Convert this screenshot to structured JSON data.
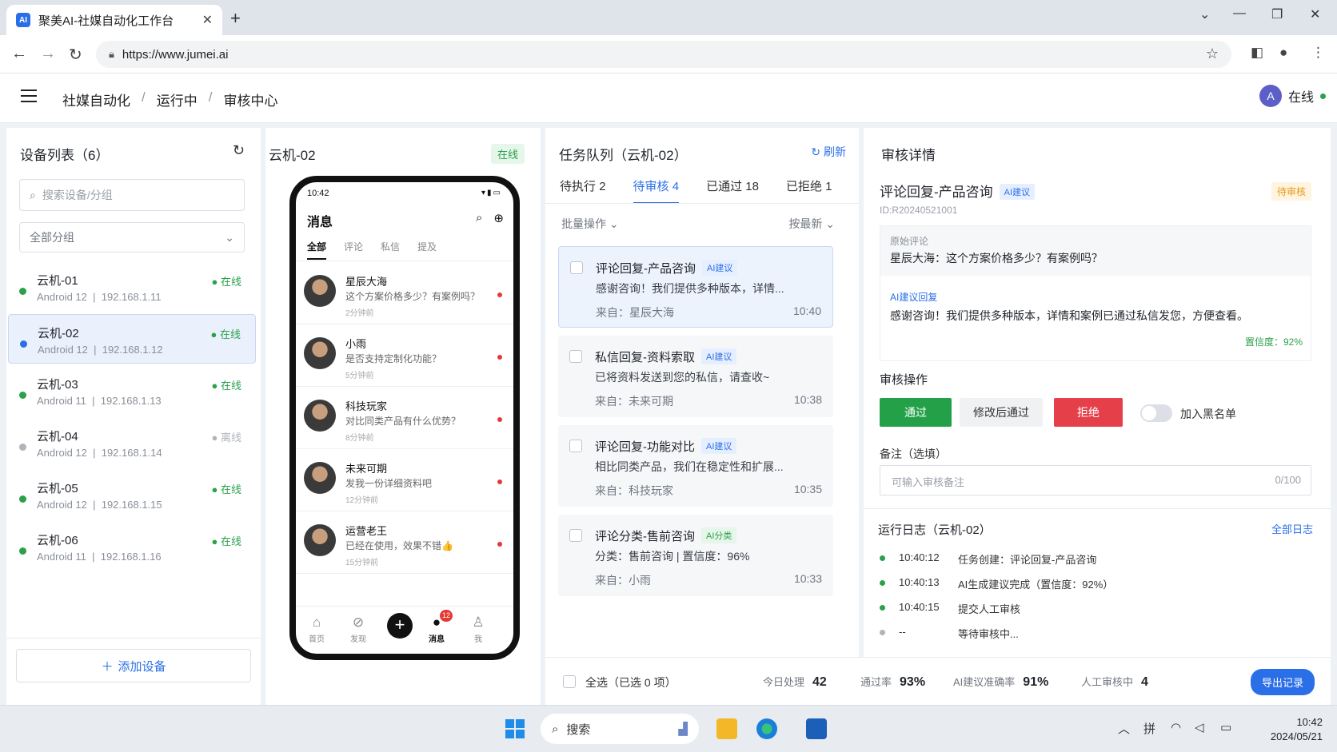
{
  "browser": {
    "tab_title": "聚美AI-社媒自动化工作台",
    "url": "https://www.jumei.ai"
  },
  "header": {
    "breadcrumbs": [
      "社媒自动化",
      "运行中",
      "审核中心"
    ],
    "user_initial": "A",
    "user_status": "在线"
  },
  "devices": {
    "title": "设备列表（6）",
    "search_placeholder": "搜索设备/分组",
    "group_select": "全部分组",
    "items": [
      {
        "name": "云机-01",
        "os": "Android 12",
        "ip": "192.168.1.11",
        "status": "在线",
        "online": true
      },
      {
        "name": "云机-02",
        "os": "Android 12",
        "ip": "192.168.1.12",
        "status": "在线",
        "online": true
      },
      {
        "name": "云机-03",
        "os": "Android 11",
        "ip": "192.168.1.13",
        "status": "在线",
        "online": true
      },
      {
        "name": "云机-04",
        "os": "Android 12",
        "ip": "192.168.1.14",
        "status": "离线",
        "online": false
      },
      {
        "name": "云机-05",
        "os": "Android 12",
        "ip": "192.168.1.15",
        "status": "在线",
        "online": true
      },
      {
        "name": "云机-06",
        "os": "Android 11",
        "ip": "192.168.1.16",
        "status": "在线",
        "online": true
      }
    ],
    "add_label": "添加设备"
  },
  "phone_panel": {
    "title": "云机-02",
    "status": "在线",
    "phone": {
      "time": "10:42",
      "title": "消息",
      "tabs": [
        "全部",
        "评论",
        "私信",
        "提及"
      ],
      "messages": [
        {
          "name": "星辰大海",
          "text": "这个方案价格多少？有案例吗？",
          "time": "2分钟前"
        },
        {
          "name": "小雨",
          "text": "是否支持定制化功能？",
          "time": "5分钟前"
        },
        {
          "name": "科技玩家",
          "text": "对比同类产品有什么优势？",
          "time": "8分钟前"
        },
        {
          "name": "未来可期",
          "text": "发我一份详细资料吧",
          "time": "12分钟前"
        },
        {
          "name": "运营老王",
          "text": "已经在使用，效果不错👍",
          "time": "15分钟前"
        }
      ],
      "nav": [
        "首页",
        "发现",
        "消息",
        "我"
      ],
      "badge": "12"
    }
  },
  "queue": {
    "title": "任务队列（云机-02）",
    "refresh": "刷新",
    "tabs": [
      {
        "label": "待执行",
        "count": "2"
      },
      {
        "label": "待审核",
        "count": "4"
      },
      {
        "label": "已通过",
        "count": "18"
      },
      {
        "label": "已拒绝",
        "count": "1"
      }
    ],
    "batch": "批量操作",
    "sort": "按最新",
    "tasks": [
      {
        "title": "评论回复-产品咨询",
        "tag": "AI建议",
        "desc": "感谢咨询！我们提供多种版本，详情...",
        "from": "来自：星辰大海",
        "time": "10:40"
      },
      {
        "title": "私信回复-资料索取",
        "tag": "AI建议",
        "desc": "已将资料发送到您的私信，请查收~",
        "from": "来自：未来可期",
        "time": "10:38"
      },
      {
        "title": "评论回复-功能对比",
        "tag": "AI建议",
        "desc": "相比同类产品，我们在稳定性和扩展...",
        "from": "来自：科技玩家",
        "time": "10:35"
      },
      {
        "title": "评论分类-售前咨询",
        "tag": "AI分类",
        "desc": "分类：售前咨询 | 置信度：96%",
        "from": "来自：小雨",
        "time": "10:33"
      }
    ]
  },
  "bottom": {
    "select_all": "全选（已选 0 项）",
    "stats": [
      {
        "label": "今日处理",
        "value": "42"
      },
      {
        "label": "通过率",
        "value": "93%"
      },
      {
        "label": "AI建议准确率",
        "value": "91%"
      },
      {
        "label": "人工审核中",
        "value": "4"
      }
    ],
    "export": "导出记录"
  },
  "detail": {
    "title": "审核详情",
    "task_title": "评论回复-产品咨询",
    "tag": "AI建议",
    "status": "待审核",
    "id": "ID:R20240521001",
    "orig_label": "原始评论",
    "orig_text": "星辰大海：这个方案价格多少？有案例吗？",
    "ai_label": "AI建议回复",
    "ai_text": "感谢咨询！我们提供多种版本，详情和案例已通过私信发您，方便查看。",
    "confidence": "置信度：92%",
    "ops_title": "审核操作",
    "btn_pass": "通过",
    "btn_edit": "修改后通过",
    "btn_reject": "拒绝",
    "blacklist": "加入黑名单",
    "note_label": "备注（选填）",
    "note_placeholder": "可输入审核备注",
    "note_count": "0/100"
  },
  "log": {
    "title": "运行日志（云机-02）",
    "all": "全部日志",
    "entries": [
      {
        "time": "10:40:12",
        "msg": "任务创建：评论回复-产品咨询",
        "done": true
      },
      {
        "time": "10:40:13",
        "msg": "AI生成建议完成（置信度：92%）",
        "done": true
      },
      {
        "time": "10:40:15",
        "msg": "提交人工审核",
        "done": true
      },
      {
        "time": "--",
        "msg": "等待审核中...",
        "done": false
      }
    ]
  },
  "taskbar": {
    "search": "搜索",
    "time": "10:42",
    "date": "2024/05/21"
  },
  "colors": {
    "accent": "#2b6fe8",
    "online": "#2aa14a",
    "offline": "#b0b4bb",
    "reject": "#e5404a",
    "pass": "#24a148"
  }
}
